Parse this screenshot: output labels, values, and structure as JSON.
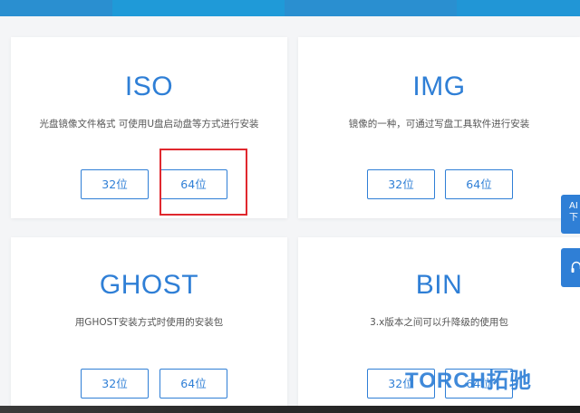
{
  "colors": {
    "accent": "#2f7fd6",
    "highlight": "#e0282e",
    "top_strip": [
      "#2a8fd0",
      "#1f9ad8",
      "#2a8fd0",
      "#2196d6"
    ]
  },
  "cards": [
    {
      "title": "ISO",
      "desc": "光盘镜像文件格式 可使用U盘启动盘等方式进行安装",
      "btn32": "32位",
      "btn64": "64位"
    },
    {
      "title": "IMG",
      "desc": "镜像的一种，可通过写盘工具软件进行安装",
      "btn32": "32位",
      "btn64": "64位"
    },
    {
      "title": "GHOST",
      "desc": "用GHOST安装方式时使用的安装包",
      "btn32": "32位",
      "btn64": "64位"
    },
    {
      "title": "BIN",
      "desc": "3.x版本之间可以升降级的使用包",
      "btn32": "32位",
      "btn64": "64位"
    }
  ],
  "side_tabs": {
    "download_text": "AI 下",
    "contact_icon": "headset-icon"
  },
  "watermark": "TORCH拓驰"
}
